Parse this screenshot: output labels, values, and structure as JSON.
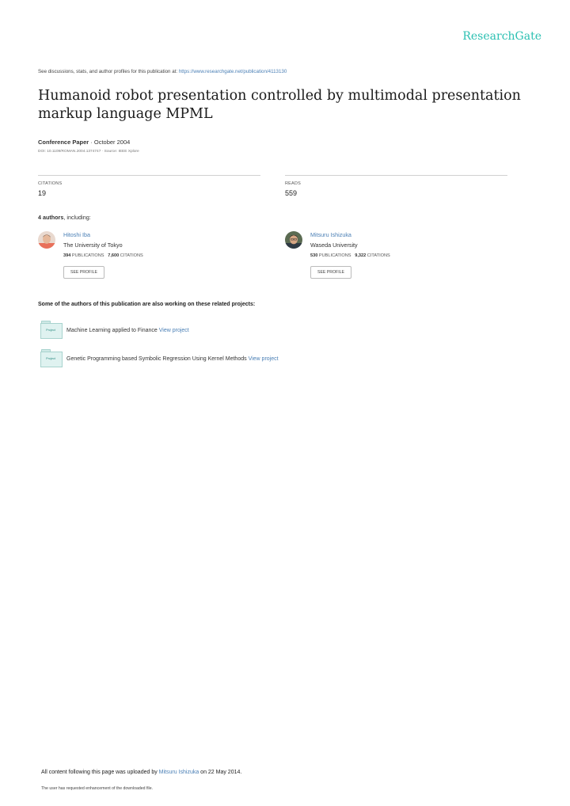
{
  "brand": "ResearchGate",
  "discussion": {
    "text": "See discussions, stats, and author profiles for this publication at: ",
    "url": "https://www.researchgate.net/publication/4113130"
  },
  "title": "Humanoid robot presentation controlled by multimodal presentation markup language MPML",
  "meta": {
    "type": "Conference Paper",
    "date": " · October 2004",
    "doi": "DOI: 10.1109/ROMAN.2004.1374747 · Source: IEEE Xplore"
  },
  "stats": {
    "citations_label": "CITATIONS",
    "citations_value": "19",
    "reads_label": "READS",
    "reads_value": "559"
  },
  "authors_heading": {
    "count": "4 authors",
    "suffix": ", including:"
  },
  "authors": [
    {
      "name": "Hitoshi Iba",
      "institution": "The University of Tokyo",
      "publications": "394",
      "publications_label": "PUBLICATIONS",
      "citations": "7,600",
      "citations_label": "CITATIONS",
      "button": "SEE PROFILE"
    },
    {
      "name": "Mitsuru Ishizuka",
      "institution": "Waseda University",
      "publications": "530",
      "publications_label": "PUBLICATIONS",
      "citations": "9,322",
      "citations_label": "CITATIONS",
      "button": "SEE PROFILE"
    }
  ],
  "related_heading": "Some of the authors of this publication are also working on these related projects:",
  "projects": [
    {
      "badge": "Project",
      "title": "Machine Learning applied to Finance ",
      "link": "View project"
    },
    {
      "badge": "Project",
      "title": "Genetic Programming based Symbolic Regression Using Kernel Methods ",
      "link": "View project"
    }
  ],
  "footer": {
    "prefix": "All content following this page was uploaded by ",
    "uploader": "Mitsuru Ishizuka",
    "suffix": " on 22 May 2014.",
    "note": "The user has requested enhancement of the downloaded file."
  }
}
